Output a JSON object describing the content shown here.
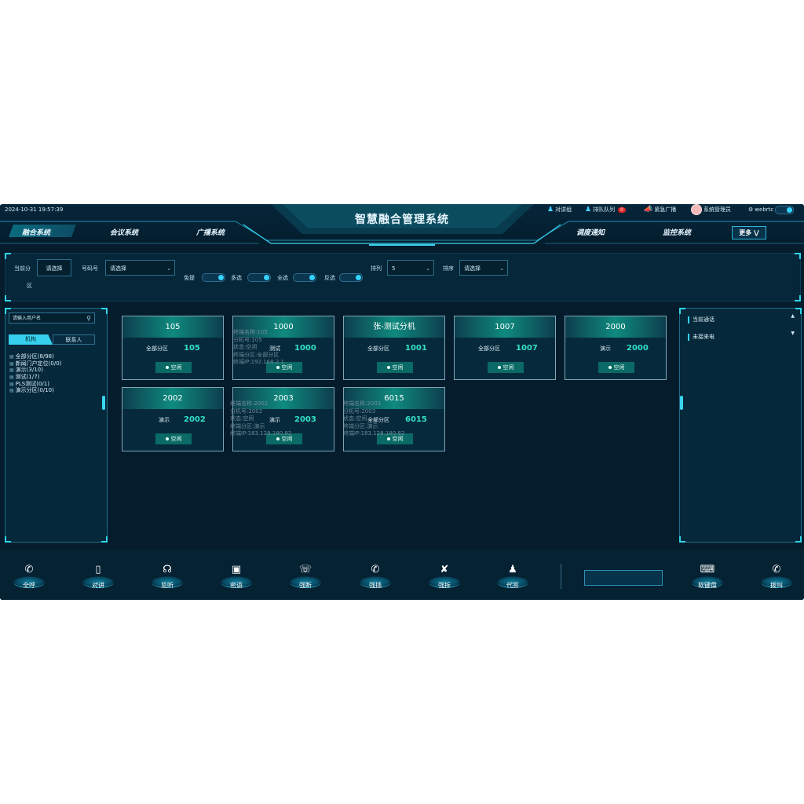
{
  "header": {
    "datetime": "2024-10-31 19:57:39",
    "title": "智慧融合管理系统",
    "tools": [
      {
        "icon": "intercom-group-icon",
        "label": "对讲组"
      },
      {
        "icon": "queue-icon",
        "label": "排队队列",
        "badge": "0"
      },
      {
        "icon": "megaphone-icon",
        "label": "紧急广播"
      },
      {
        "icon": "avatar",
        "label": "系统管理员"
      },
      {
        "icon": "settings-icon",
        "label": "webrtc"
      }
    ]
  },
  "nav": {
    "left": [
      "融合系统",
      "会议系统",
      "广播系统"
    ],
    "right": [
      "调度通知",
      "监控系统"
    ],
    "active": "融合系统",
    "more": "更多"
  },
  "filter": {
    "current_zone_label": "当前分",
    "current_zone_label2": "区",
    "current_zone_value": "请选择",
    "group_label": "号码号",
    "group_placeholder": "请选择",
    "toggles": [
      {
        "label": "免提"
      },
      {
        "label": "多选"
      },
      {
        "label": "全选"
      },
      {
        "label": "反选"
      }
    ],
    "columns_label": "排列",
    "columns_value": "5",
    "sort_label": "排序",
    "sort_placeholder": "请选择"
  },
  "left_panel": {
    "search_placeholder": "请输入用户名",
    "tabs": [
      "机构",
      "联系人"
    ],
    "tree": [
      "全部分区(8/98)",
      "新闻门户定位(0/0)",
      "演示(3/10)",
      "测试(1/7)",
      "PLS测试(0/1)",
      "演示分区(0/10)"
    ]
  },
  "cards": [
    {
      "title": "105",
      "label": "全部分区",
      "number": "105",
      "status": "空闲",
      "overlay": [
        "终端名称:105",
        "分机号:105",
        "状态:空闲",
        "终端分区:全部分区",
        "终端IP:192.168.2.1"
      ]
    },
    {
      "title": "1000",
      "label": "测试",
      "number": "1000",
      "status": "空闲"
    },
    {
      "title": "张-测试分机",
      "label": "全部分区",
      "number": "1001",
      "status": "空闲"
    },
    {
      "title": "1007",
      "label": "全部分区",
      "number": "1007",
      "status": "空闲"
    },
    {
      "title": "2000",
      "label": "演示",
      "number": "2000",
      "status": "空闲"
    },
    {
      "title": "2002",
      "label": "演示",
      "number": "2002",
      "status": "空闲"
    },
    {
      "title": "2003",
      "label": "演示",
      "number": "2003",
      "status": "空闲",
      "overlay": [
        "终端名称:2002",
        "分机号:2002",
        "状态:空闲",
        "终端分区:演示",
        "终端IP:183.128.180.82"
      ]
    },
    {
      "title": "6015",
      "label": "全部分区",
      "number": "6015",
      "status": "空闲",
      "overlay": [
        "终端名称:2003",
        "分机号:2003",
        "状态:空闲",
        "终端分区:演示",
        "终端IP:183.128.180.82"
      ]
    }
  ],
  "right_panel": {
    "items": [
      "当前通话",
      "未接来电"
    ]
  },
  "actions": [
    {
      "icon": "phone-call-icon",
      "label": "全呼"
    },
    {
      "icon": "walkie-talkie-icon",
      "label": "对讲"
    },
    {
      "icon": "headset-icon",
      "label": "监听"
    },
    {
      "icon": "lock-icon",
      "label": "密语"
    },
    {
      "icon": "hangup-icon",
      "label": "强断"
    },
    {
      "icon": "barge-in-icon",
      "label": "强插"
    },
    {
      "icon": "force-disconnect-icon",
      "label": "强拆"
    },
    {
      "icon": "agent-icon",
      "label": "代答"
    }
  ],
  "actions_right": [
    {
      "icon": "keyboard-icon",
      "label": "软键盘"
    },
    {
      "icon": "call-icon",
      "label": "拨叫"
    }
  ],
  "colors": {
    "background": "#041c2b",
    "accent": "#35d3ff",
    "status_green": "#0b6a66",
    "number_teal": "#33e0c8"
  }
}
